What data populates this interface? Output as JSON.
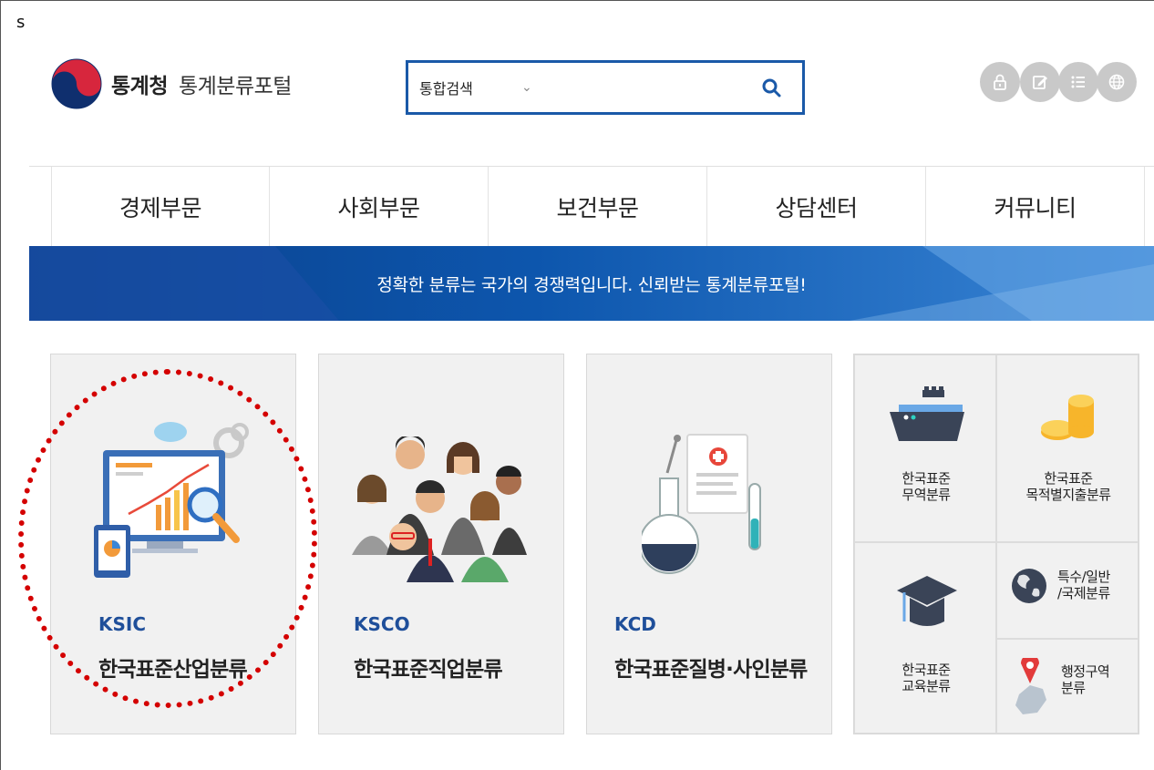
{
  "corner_label": "s",
  "header": {
    "org_name": "통계청",
    "portal_name": "통계분류포털",
    "search": {
      "scope": "통합검색",
      "value": ""
    },
    "util_icons": [
      "lock-icon",
      "edit-icon",
      "list-icon",
      "globe-icon"
    ]
  },
  "nav": {
    "items": [
      "경제부문",
      "사회부문",
      "보건부문",
      "상담센터",
      "커뮤니티"
    ]
  },
  "banner": {
    "text": "정확한 분류는 국가의 경쟁력입니다. 신뢰받는 통계분류포털!"
  },
  "cards": [
    {
      "code": "KSIC",
      "name": "한국표준산업분류"
    },
    {
      "code": "KSCO",
      "name": "한국표준직업분류"
    },
    {
      "code": "KCD",
      "name": "한국표준질병·사인분류"
    }
  ],
  "small_cards": {
    "trade": {
      "line1": "한국표준",
      "line2": "무역분류"
    },
    "expenditure": {
      "line1": "한국표준",
      "line2": "목적별지출분류"
    },
    "special": {
      "line1": "특수/일반",
      "line2": "/국제분류"
    },
    "education": {
      "line1": "한국표준",
      "line2": "교육분류"
    },
    "admin": {
      "line1": "행정구역",
      "line2": "분류"
    }
  },
  "colors": {
    "brand_blue": "#0d4c9c",
    "code_blue": "#1f4f9a",
    "highlight_red": "#d40000"
  }
}
